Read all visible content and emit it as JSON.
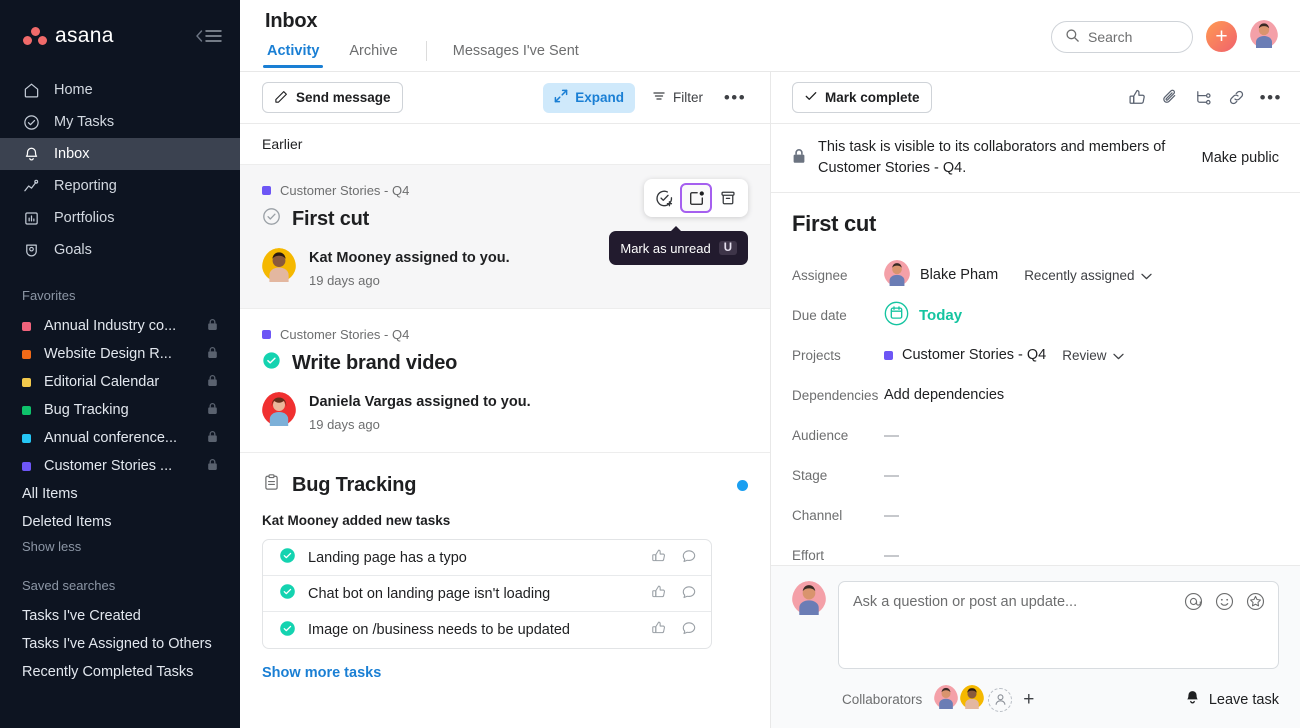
{
  "sidebar": {
    "brand": "asana",
    "collapse_icon": "collapse-sidebar-icon",
    "nav": [
      {
        "label": "Home",
        "icon": "home-icon",
        "active": false
      },
      {
        "label": "My Tasks",
        "icon": "check-circle-icon",
        "active": false
      },
      {
        "label": "Inbox",
        "icon": "bell-icon",
        "active": true
      },
      {
        "label": "Reporting",
        "icon": "chart-line-icon",
        "active": false
      },
      {
        "label": "Portfolios",
        "icon": "portfolio-icon",
        "active": false
      },
      {
        "label": "Goals",
        "icon": "goal-icon",
        "active": false
      }
    ],
    "favorites_title": "Favorites",
    "favorites": [
      {
        "label": "Annual Industry co...",
        "color": "#f0637c",
        "locked": true
      },
      {
        "label": "Website Design R...",
        "color": "#f06a18",
        "locked": true
      },
      {
        "label": "Editorial Calendar",
        "color": "#f2c94c",
        "locked": true
      },
      {
        "label": "Bug Tracking",
        "color": "#0ec26b",
        "locked": true
      },
      {
        "label": "Annual conference...",
        "color": "#25c6f5",
        "locked": true
      },
      {
        "label": "Customer Stories ...",
        "color": "#6d56f5",
        "locked": true
      }
    ],
    "links": [
      "All Items",
      "Deleted Items"
    ],
    "show_less": "Show less",
    "saved_searches_title": "Saved searches",
    "saved_searches": [
      "Tasks I've Created",
      "Tasks I've Assigned to Others",
      "Recently Completed Tasks"
    ]
  },
  "header": {
    "title": "Inbox",
    "tabs": [
      {
        "label": "Activity",
        "active": true
      },
      {
        "label": "Archive",
        "active": false
      },
      {
        "label": "Messages I've Sent",
        "active": false
      }
    ],
    "search_placeholder": "Search",
    "add_button_label": "+",
    "avatar_name": "Blake Pham"
  },
  "inbox": {
    "toolbar": {
      "send_message": "Send message",
      "expand": "Expand",
      "filter": "Filter",
      "more": "•••"
    },
    "group_label": "Earlier",
    "cards": [
      {
        "project": "Customer Stories - Q4",
        "project_color": "#6d56f5",
        "title": "First cut",
        "completed": false,
        "actor": "Kat Mooney assigned to you.",
        "time": "19 days ago",
        "selected": true,
        "hover_actions": [
          "mark-complete-icon",
          "mark-unread-icon",
          "archive-icon"
        ],
        "tooltip": {
          "text": "Mark as unread",
          "key": "U"
        }
      },
      {
        "project": "Customer Stories - Q4",
        "project_color": "#6d56f5",
        "title": "Write brand video",
        "completed": true,
        "actor": "Daniela Vargas assigned to you.",
        "time": "19 days ago",
        "selected": false
      }
    ],
    "bug_section": {
      "title": "Bug Tracking",
      "unread": true,
      "subtitle": "Kat Mooney added new tasks",
      "tasks": [
        "Landing page has a typo",
        "Chat bot on landing page isn't loading",
        "Image on /business needs to be updated"
      ],
      "show_more": "Show more tasks"
    }
  },
  "detail": {
    "mark_complete": "Mark complete",
    "actions": [
      "like-icon",
      "attachment-icon",
      "subtask-icon",
      "link-icon",
      "more-icon"
    ],
    "privacy_text": "This task is visible to its collaborators and members of Customer Stories - Q4.",
    "make_public": "Make public",
    "title": "First cut",
    "fields": [
      {
        "label": "Assignee",
        "value": "Blake Pham",
        "extra": "Recently assigned",
        "type": "assignee"
      },
      {
        "label": "Due date",
        "value": "Today",
        "type": "date"
      },
      {
        "label": "Projects",
        "value": "Customer Stories - Q4",
        "extra": "Review",
        "color": "#6d56f5",
        "type": "project"
      },
      {
        "label": "Dependencies",
        "value": "Add dependencies",
        "type": "link"
      },
      {
        "label": "Audience",
        "value": "—",
        "type": "dash"
      },
      {
        "label": "Stage",
        "value": "—",
        "type": "dash"
      },
      {
        "label": "Channel",
        "value": "—",
        "type": "dash"
      },
      {
        "label": "Effort",
        "value": "—",
        "type": "dash"
      }
    ],
    "comment_placeholder": "Ask a question or post an update...",
    "comment_tools": [
      "mention-icon",
      "emoji-icon",
      "sticker-icon"
    ],
    "collaborators_label": "Collaborators",
    "add_collaborator": "+",
    "leave_task": "Leave task"
  },
  "colors": {
    "accent_blue": "#1a7fd4",
    "brand_coral": "#f06a6a",
    "teal": "#14c4a0",
    "purple_highlight": "#a55fef",
    "sidebar_bg": "#0d1421"
  }
}
